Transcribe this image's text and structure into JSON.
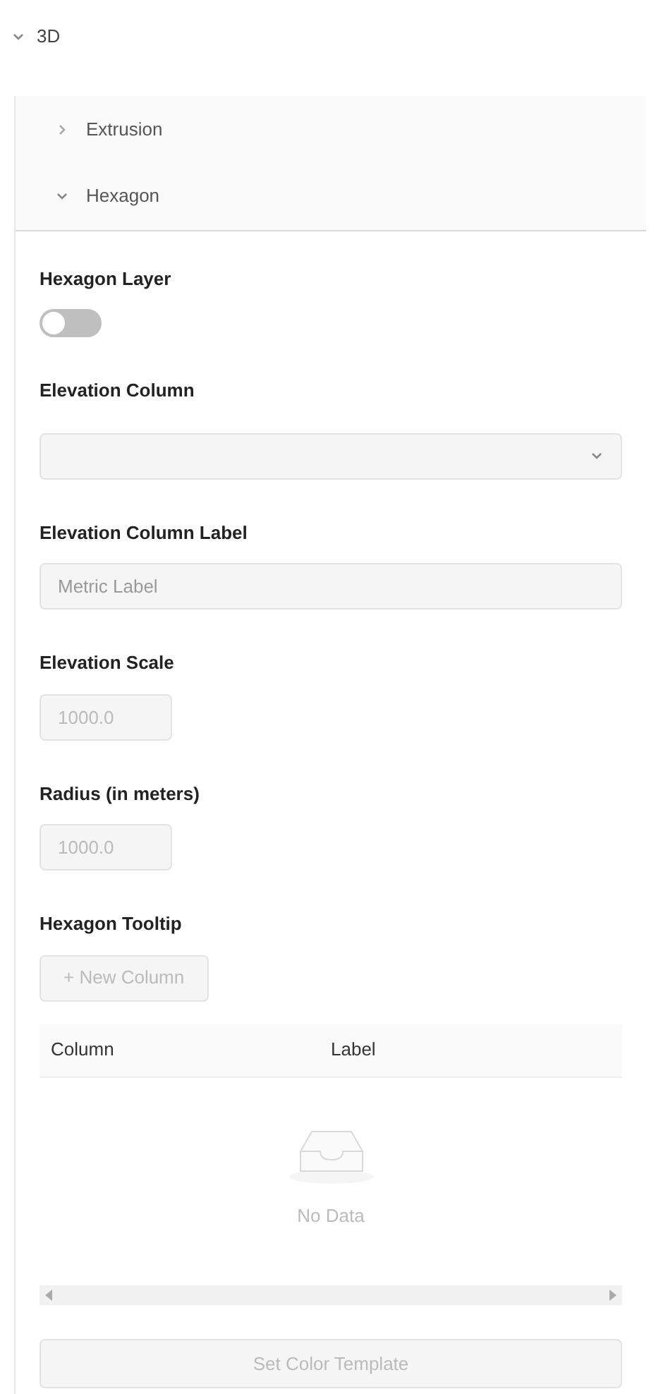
{
  "section": {
    "title": "3D",
    "expanded": true
  },
  "panels": [
    {
      "title": "Extrusion",
      "expanded": false
    },
    {
      "title": "Hexagon",
      "expanded": true
    }
  ],
  "hexagon": {
    "layer_toggle": {
      "label": "Hexagon Layer",
      "on": false
    },
    "elevation_column": {
      "label": "Elevation Column",
      "disabled": true
    },
    "elevation_column_label": {
      "label": "Elevation Column Label",
      "placeholder": "Metric Label",
      "disabled": true
    },
    "elevation_scale": {
      "label": "Elevation Scale",
      "value": "1000.0",
      "disabled": true
    },
    "radius": {
      "label": "Radius (in meters)",
      "value": "1000.0",
      "disabled": true
    },
    "tooltip": {
      "label": "Hexagon Tooltip",
      "add_button": "+ New Column",
      "disabled": true,
      "table": {
        "columns": [
          "Column",
          "Label"
        ],
        "empty_text": "No Data"
      }
    },
    "template_button": {
      "label": "Set Color Template",
      "disabled": true
    }
  }
}
